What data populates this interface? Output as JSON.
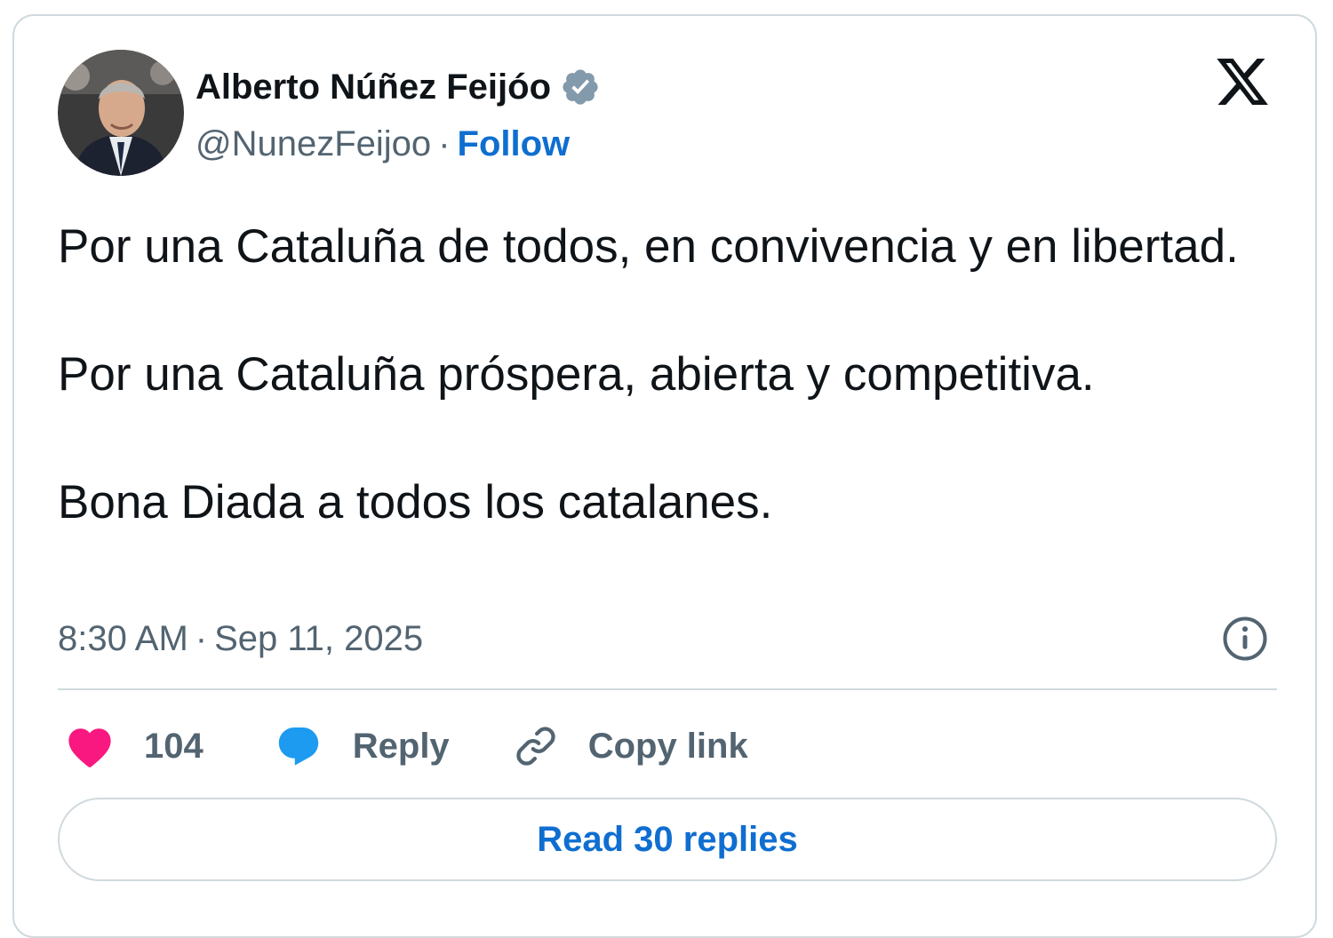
{
  "author": {
    "name": "Alberto Núñez Feijóo",
    "handle": "@NunezFeijoo",
    "separator": "·",
    "follow_label": "Follow",
    "verified_icon": "verified-badge-icon",
    "verified_color": "#829aab"
  },
  "tweet": {
    "text": "Por una Cataluña de todos, en convivencia y en libertad.\n\nPor una Cataluña próspera, abierta y competitiva.\n\nBona Diada a todos los catalanes."
  },
  "meta": {
    "time": "8:30 AM",
    "separator": "·",
    "date": "Sep 11, 2025"
  },
  "actions": {
    "likes_count": "104",
    "reply_label": "Reply",
    "copy_link_label": "Copy link"
  },
  "read_replies_label": "Read 30 replies",
  "colors": {
    "like": "#f91880",
    "reply": "#1d9bf0",
    "link_blue": "#0f6ed0",
    "muted": "#536471",
    "border": "#cfd9de"
  },
  "icons": {
    "brand": "x-logo-icon",
    "info": "info-icon",
    "like": "heart-icon",
    "reply": "speech-bubble-icon",
    "copy": "link-icon"
  }
}
